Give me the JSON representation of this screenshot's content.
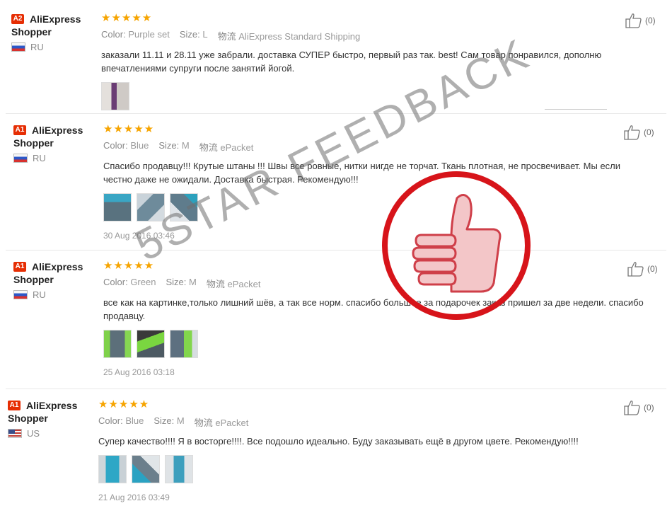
{
  "labels": {
    "color": "Color:",
    "size": "Size:",
    "shipping": "物流"
  },
  "reviews": [
    {
      "level": "A2",
      "user_line1": "AliExpress",
      "user_line2": "Shopper",
      "flag": "ru-flag",
      "country": "RU",
      "stars": "★★★★★",
      "color_value": "Purple set",
      "size_value": "L",
      "shipping_value": "AliExpress Standard Shipping",
      "text": "заказали 11.11 и 28.11 уже забрали. доставка СУПЕР быстро, первый раз так. best! Сам товар понравился, дополню впечатлениями супруги после занятий йогой.",
      "helpful_count": "(0)",
      "date": ""
    },
    {
      "level": "A1",
      "user_line1": "AliExpress",
      "user_line2": "Shopper",
      "flag": "ru-flag",
      "country": "RU",
      "stars": "★★★★★",
      "color_value": "Blue",
      "size_value": "M",
      "shipping_value": "ePacket",
      "text": "Спасибо продавцу!!! Крутые штаны !!! Швы все ровные, нитки нигде не торчат. Ткань плотная, не просвечивает. Мы если честно даже не ожидали. Доставка быстрая. Рекомендую!!!",
      "helpful_count": "(0)",
      "date": "30 Aug 2016 03:46"
    },
    {
      "level": "A1",
      "user_line1": "AliExpress",
      "user_line2": "Shopper",
      "flag": "ru-flag",
      "country": "RU",
      "stars": "★★★★★",
      "color_value": "Green",
      "size_value": "M",
      "shipping_value": "ePacket",
      "text": "все как на картинке,только лишний шёв, а так все норм. спасибо большое за подарочек заказ пришел за две недели. спасибо продавцу.",
      "helpful_count": "(0)",
      "date": "25 Aug 2016 03:18"
    },
    {
      "level": "A1",
      "user_line1": "AliExpress",
      "user_line2": "Shopper",
      "flag": "us-flag",
      "country": "US",
      "stars": "★★★★★",
      "color_value": "Blue",
      "size_value": "M",
      "shipping_value": "ePacket",
      "text": "Супер качество!!!! Я в восторге!!!!. Все подошло идеально. Буду заказывать ещё в другом цвете. Рекомендую!!!!",
      "helpful_count": "(0)",
      "date": "21 Aug 2016 03:49"
    }
  ],
  "watermark": "5STAR FEEDBACK",
  "colors": {
    "level_badge": "#e62e04",
    "stars": "#f6a400",
    "stamp_ring": "#d7141a",
    "thumb_hand": "#e87f86"
  }
}
